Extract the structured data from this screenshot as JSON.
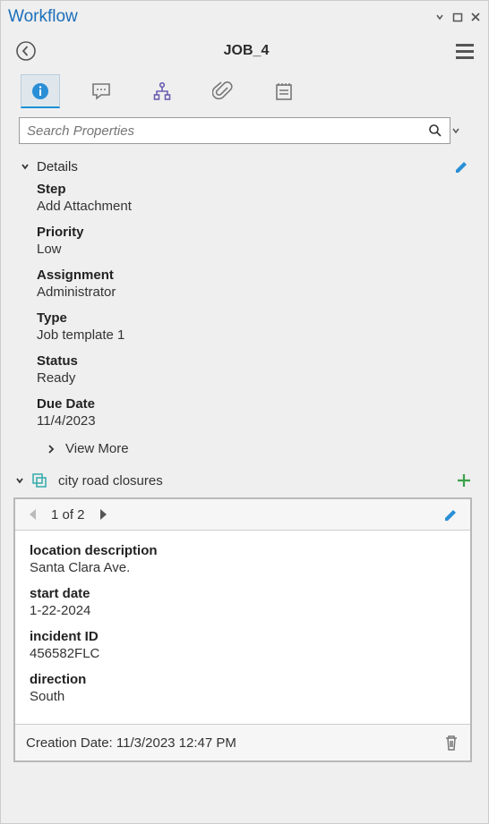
{
  "titlebar": {
    "title": "Workflow"
  },
  "header": {
    "job_title": "JOB_4"
  },
  "search": {
    "placeholder": "Search Properties"
  },
  "details": {
    "section_title": "Details",
    "step_label": "Step",
    "step_value": "Add Attachment",
    "priority_label": "Priority",
    "priority_value": "Low",
    "assignment_label": "Assignment",
    "assignment_value": "Administrator",
    "type_label": "Type",
    "type_value": "Job template 1",
    "status_label": "Status",
    "status_value": "Ready",
    "duedate_label": "Due Date",
    "duedate_value": "11/4/2023",
    "view_more": "View More"
  },
  "related": {
    "title": "city road closures",
    "pager": "1 of 2",
    "fields": {
      "location_label": "location description",
      "location_value": "Santa Clara Ave.",
      "start_label": "start date",
      "start_value": "1-22-2024",
      "incident_label": "incident ID",
      "incident_value": "456582FLC",
      "direction_label": "direction",
      "direction_value": "South"
    },
    "footer": "Creation Date: 11/3/2023 12:47 PM"
  }
}
